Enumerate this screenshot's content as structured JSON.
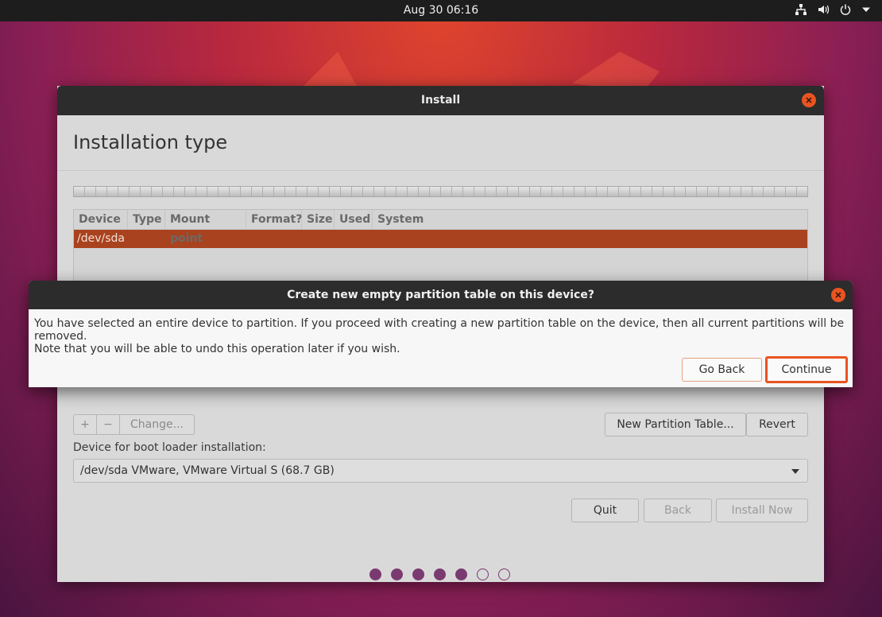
{
  "topbar": {
    "clock": "Aug 30  06:16",
    "icons": [
      "network-icon",
      "volume-icon",
      "power-icon",
      "chevron-down-icon"
    ]
  },
  "window": {
    "title": "Install",
    "page_title": "Installation type",
    "table": {
      "columns": [
        "Device",
        "Type",
        "Mount point",
        "Format?",
        "Size",
        "Used",
        "System"
      ],
      "rows": [
        {
          "device": "/dev/sda",
          "selected": true
        }
      ]
    },
    "toolbar": {
      "add_label": "+",
      "remove_label": "−",
      "change_label": "Change...",
      "new_table_label": "New Partition Table...",
      "revert_label": "Revert"
    },
    "boot_loader_label": "Device for boot loader installation:",
    "boot_loader_value": "/dev/sda VMware, VMware Virtual S (68.7 GB)",
    "buttons": {
      "quit": "Quit",
      "back": "Back",
      "install_now": "Install Now"
    },
    "progress": {
      "total_steps": 7,
      "completed_steps": 5
    }
  },
  "dialog": {
    "title": "Create new empty partition table on this device?",
    "message1": "You have selected an entire device to partition. If you proceed with creating a new partition table on the device, then all current partitions will be removed.",
    "message2": "Note that you will be able to undo this operation later if you wish.",
    "go_back_label": "Go Back",
    "continue_label": "Continue"
  },
  "colors": {
    "accent": "#e95420",
    "selected_row": "#a9421e",
    "progress_dot": "#7a3a70"
  }
}
